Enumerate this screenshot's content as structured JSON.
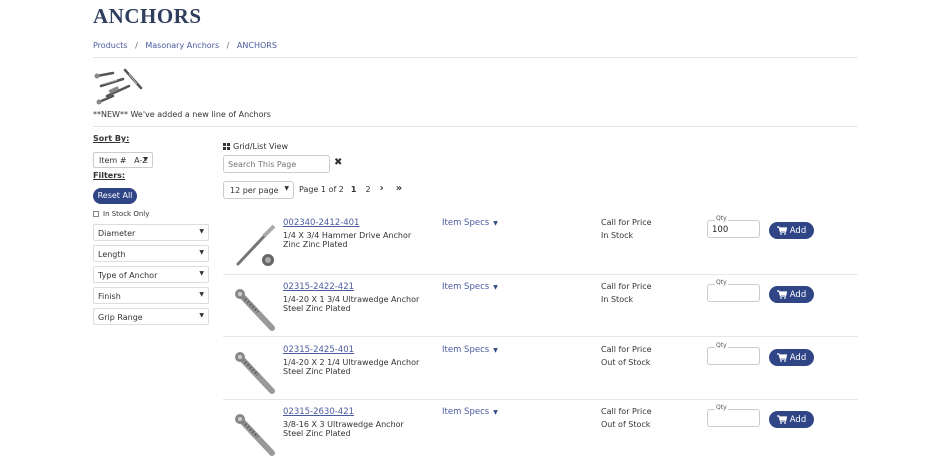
{
  "page": {
    "title": "ANCHORS"
  },
  "breadcrumb": {
    "items": [
      "Products",
      "Masonary Anchors",
      "ANCHORS"
    ]
  },
  "promo": {
    "text": "**NEW** We've added a new line of Anchors"
  },
  "sort": {
    "label": "Sort By:",
    "selected": "Item #   A-Z"
  },
  "filters": {
    "label": "Filters:",
    "reset_label": "Reset All",
    "in_stock_label": "In Stock Only",
    "selects": [
      "Diameter",
      "Length",
      "Type of Anchor",
      "Finish",
      "Grip Range"
    ]
  },
  "toolbar": {
    "grid_list_label": "Grid/List View",
    "search_placeholder": "Search This Page",
    "clear_icon": "✖",
    "per_page": "12 per page",
    "page_text": "Page 1 of 2",
    "pages": [
      "1",
      "2"
    ],
    "next_icon": "›",
    "last_icon": "»"
  },
  "products": [
    {
      "number": "002340-2412-401",
      "description": "1/4 X 3/4 Hammer Drive Anchor Zinc Zinc Plated",
      "specs_label": "Item Specs",
      "price": "Call for Price",
      "stock": "In Stock",
      "qty_label": "Qty",
      "qty": "100",
      "add_label": "Add"
    },
    {
      "number": "02315-2422-421",
      "description": "1/4-20 X 1 3/4 Ultrawedge Anchor Steel Zinc Plated",
      "specs_label": "Item Specs",
      "price": "Call for Price",
      "stock": "In Stock",
      "qty_label": "Qty",
      "qty": "",
      "add_label": "Add"
    },
    {
      "number": "02315-2425-401",
      "description": "1/4-20 X 2 1/4 Ultrawedge Anchor Steel Zinc Plated",
      "specs_label": "Item Specs",
      "price": "Call for Price",
      "stock": "Out of Stock",
      "qty_label": "Qty",
      "qty": "",
      "add_label": "Add"
    },
    {
      "number": "02315-2630-421",
      "description": "3/8-16 X 3 Ultrawedge Anchor Steel Zinc Plated",
      "specs_label": "Item Specs",
      "price": "Call for Price",
      "stock": "Out of Stock",
      "qty_label": "Qty",
      "qty": "",
      "add_label": "Add"
    }
  ],
  "colors": {
    "primary": "#2f4586",
    "link": "#4a5a9e",
    "title": "#2f3e5e"
  },
  "icons": {
    "cart": "cart-icon",
    "grid": "grid-icon",
    "caret": "caret-down-icon"
  }
}
